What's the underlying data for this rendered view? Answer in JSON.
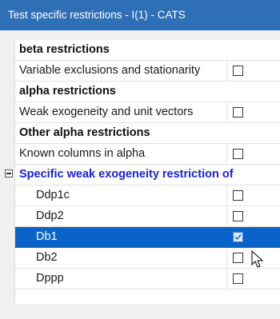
{
  "window": {
    "title": "Test specific restrictions - I(1) - CATS"
  },
  "rows": [
    {
      "label": "beta restrictions",
      "kind": "header"
    },
    {
      "label": "Variable exclusions and stationarity",
      "kind": "item",
      "checked": false
    },
    {
      "label": "alpha restrictions",
      "kind": "header"
    },
    {
      "label": "Weak exogeneity and unit vectors",
      "kind": "item",
      "checked": false
    },
    {
      "label": "Other alpha restrictions",
      "kind": "header"
    },
    {
      "label": "Known columns in alpha",
      "kind": "item",
      "checked": false
    },
    {
      "label": "Specific weak exogeneity restriction of",
      "kind": "group",
      "expanded": true
    },
    {
      "label": "Ddp1c",
      "kind": "sub",
      "checked": false
    },
    {
      "label": "Ddp2",
      "kind": "sub",
      "checked": false
    },
    {
      "label": "Db1",
      "kind": "sub",
      "checked": true,
      "selected": true
    },
    {
      "label": "Db2",
      "kind": "sub",
      "checked": false
    },
    {
      "label": "Dppp",
      "kind": "sub",
      "checked": false
    }
  ],
  "colors": {
    "title_bar": "#2f6fb5",
    "selection": "#0a63c9",
    "group_text": "#1a23d6"
  },
  "icons": {
    "expander": "minus-box-icon",
    "cursor": "mouse-pointer-icon",
    "check": "checkmark-icon"
  }
}
